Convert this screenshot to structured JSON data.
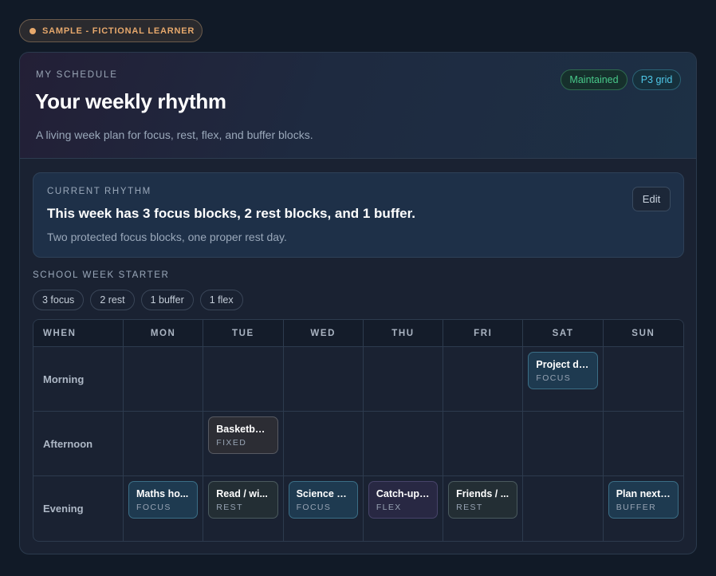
{
  "sample_badge": {
    "label": "SAMPLE - FICTIONAL LEARNER",
    "color": "#e6a86c"
  },
  "header": {
    "eyebrow": "MY SCHEDULE",
    "title": "Your weekly rhythm",
    "subtitle": "A living week plan for focus, rest, flex, and buffer blocks.",
    "tags": [
      "Maintained",
      "P3 grid"
    ]
  },
  "rhythm": {
    "eyebrow": "CURRENT RHYTHM",
    "title": "This week has 3 focus blocks, 2 rest blocks, and 1 buffer.",
    "subtitle": "Two protected focus blocks, one proper rest day.",
    "edit_label": "Edit"
  },
  "starter": {
    "label": "SCHOOL WEEK STARTER",
    "chips": [
      "3 focus",
      "2 rest",
      "1 buffer",
      "1 flex"
    ]
  },
  "grid": {
    "corner": "WHEN",
    "days": [
      "MON",
      "TUE",
      "WED",
      "THU",
      "FRI",
      "SAT",
      "SUN"
    ],
    "rows": [
      "Morning",
      "Afternoon",
      "Evening"
    ],
    "blocks": {
      "morning_sat": {
        "title": "Project de...",
        "kind": "FOCUS"
      },
      "afternoon_tue": {
        "title": "Basketbal...",
        "kind": "FIXED"
      },
      "evening_mon": {
        "title": "Maths ho...",
        "kind": "FOCUS"
      },
      "evening_tue": {
        "title": "Read / wi...",
        "kind": "REST"
      },
      "evening_wed": {
        "title": "Science p...",
        "kind": "FOCUS"
      },
      "evening_thu": {
        "title": "Catch-up ...",
        "kind": "FLEX"
      },
      "evening_fri": {
        "title": "Friends / ...",
        "kind": "REST"
      },
      "evening_sun": {
        "title": "Plan next ...",
        "kind": "BUFFER"
      }
    }
  },
  "colors": {
    "focus": "#3b6e86",
    "maintained": "#48c98a",
    "grid_tag": "#4fc8e8"
  }
}
